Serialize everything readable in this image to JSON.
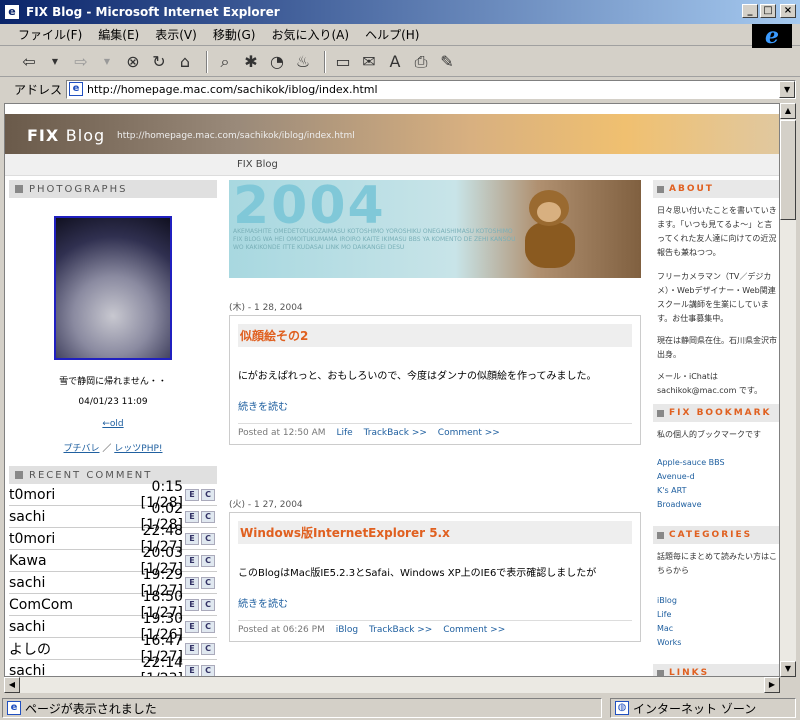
{
  "window": {
    "title": "FIX Blog - Microsoft Internet Explorer",
    "controls": [
      "_",
      "□",
      "×"
    ]
  },
  "menu": [
    "ファイル(F)",
    "編集(E)",
    "表示(V)",
    "移動(G)",
    "お気に入り(A)",
    "ヘルプ(H)"
  ],
  "address": {
    "label": "アドレス",
    "url": "http://homepage.mac.com/sachikok/iblog/index.html"
  },
  "blog": {
    "title_a": "FIX",
    "title_b": "Blog",
    "url": "http://homepage.mac.com/sachikok/iblog/index.html",
    "nav": "FIX Blog"
  },
  "left": {
    "photographs_head": "PHOTOGRAPHS",
    "photo_caption": "雪で静岡に帰れません・・",
    "photo_date": "04/01/23 11:09",
    "old_link": "←old",
    "link_a": "プチバレ",
    "link_sep": "／",
    "link_b": "レッツPHP!",
    "recent_head": "RECENT COMMENT",
    "comments": [
      {
        "name": "t0mori",
        "time": "0:15 [1/28]"
      },
      {
        "name": "sachi",
        "time": "0:02 [1/28]"
      },
      {
        "name": "t0mori",
        "time": "22:48 [1/27]"
      },
      {
        "name": "Kawa",
        "time": "20:03 [1/27]"
      },
      {
        "name": "sachi",
        "time": "19:29 [1/27]"
      },
      {
        "name": "ComCom",
        "time": "18:50 [1/27]"
      },
      {
        "name": "sachi",
        "time": "19:30 [1/26]"
      },
      {
        "name": "よしの",
        "time": "16:47 [1/27]"
      },
      {
        "name": "sachi",
        "time": "22:14 [1/23]"
      }
    ],
    "btn_e": "E",
    "btn_c": "C"
  },
  "main": {
    "banner_year": "2004",
    "banner_text": "AKEMASHITE OMEDETOUGOZAIMASU KOTOSHIMO YOROSHIKU ONEGAISHIMASU KOTOSHIMO FIX BLOG WA HEI OMOITUKUMAMA IROIRO KAITE IKIMASU BBS YA KOMENTO DE ZEHI KANSOU WO KAKIKONDE ITTE KUDASAI LINK MO DAIKANGEI DESU",
    "posts": [
      {
        "date": "(木) - 1 28, 2004",
        "title": "似顔絵その2",
        "body": "にがおえぱれっと、おもしろいので、今度はダンナの似顔絵を作ってみました。",
        "more": "続きを読む",
        "posted": "Posted at 12:50 AM",
        "category": "Life",
        "trackback": "TrackBack >>",
        "comment": "Comment >>"
      },
      {
        "date": "(火) - 1 27, 2004",
        "title": "Windows版InternetExplorer 5.x",
        "body": "このBlogはMac版IE5.2.3とSafai、Windows XP上のIE6で表示確認しましたが",
        "more": "続きを読む",
        "posted": "Posted at 06:26 PM",
        "category": "iBlog",
        "trackback": "TrackBack >>",
        "comment": "Comment >>"
      }
    ]
  },
  "right": {
    "about_head": "ABOUT",
    "about_1": "日々思い付いたことを書いていきます。「いつも見てるよ～」と言ってくれた友人達に向けての近況報告も兼ねつつ。",
    "about_2": "フリーカメラマン（TV／デジカメ）・Webデザイナー・Web関連スクール講師を生業にしています。お仕事募集中。",
    "about_3": "現在は静岡県在住。石川県金沢市出身。",
    "about_4": "メール・iChatは sachikok@mac.com です。",
    "bookmark_head": "FIX BOOKMARK",
    "bookmark_text": "私の個人的ブックマークです",
    "bookmarks": [
      "Apple-sauce BBS",
      "Avenue-d",
      "K's ART",
      "Broadwave"
    ],
    "categories_head": "CATEGORIES",
    "categories_text": "話題毎にまとめて読みたい方はこちらから",
    "categories": [
      "iBlog",
      "Life",
      "Mac",
      "Works"
    ],
    "links_head": "LINKS"
  },
  "status": {
    "text": "ページが表示されました",
    "zone": "インターネット ゾーン"
  }
}
